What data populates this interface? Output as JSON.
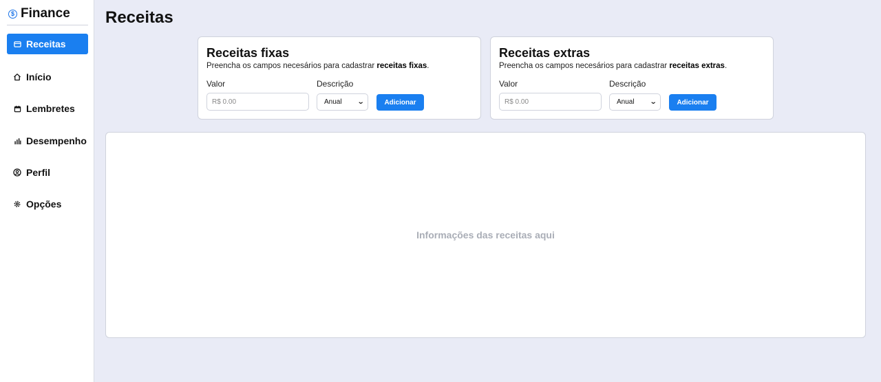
{
  "sidebar": {
    "brand": "Finance",
    "brand_icon": "dollar-circle-icon",
    "items": [
      {
        "label": "Receitas",
        "icon": "wallet-icon",
        "active": true
      },
      {
        "label": "Início",
        "icon": "home-icon",
        "active": false
      },
      {
        "label": "Lembretes",
        "icon": "calendar-icon",
        "active": false
      },
      {
        "label": "Desempenho",
        "icon": "bar-chart-icon",
        "active": false
      },
      {
        "label": "Perfil",
        "icon": "user-circle-icon",
        "active": false
      },
      {
        "label": "Opções",
        "icon": "gear-icon",
        "active": false
      }
    ]
  },
  "page": {
    "title": "Receitas"
  },
  "cards": [
    {
      "title": "Receitas fixas",
      "subtitle_prefix": "Preencha os campos necesários para cadastrar ",
      "subtitle_bold": "receitas fixas",
      "subtitle_suffix": ".",
      "value_label": "Valor",
      "value_placeholder": "R$ 0.00",
      "description_label": "Descrição",
      "description_selected": "Anual",
      "add_button": "Adicionar"
    },
    {
      "title": "Receitas extras",
      "subtitle_prefix": "Preencha os campos necesários para cadastrar ",
      "subtitle_bold": "receitas extras",
      "subtitle_suffix": ".",
      "value_label": "Valor",
      "value_placeholder": "R$ 0.00",
      "description_label": "Descrição",
      "description_selected": "Anual",
      "add_button": "Adicionar"
    }
  ],
  "info_panel": {
    "text": "Informações das receitas aqui"
  },
  "colors": {
    "accent": "#1a7ff0",
    "background": "#e9ebf6",
    "muted_text": "#a9adb6"
  }
}
